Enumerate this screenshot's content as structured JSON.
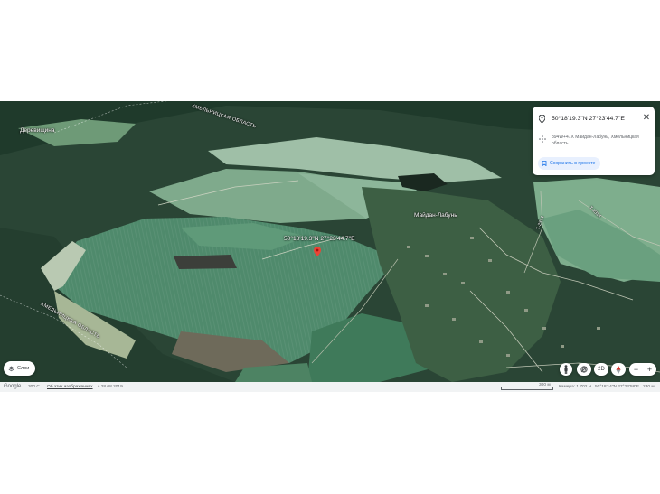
{
  "map": {
    "labels": {
      "village_left": "Деревищина",
      "village_main": "Майдан-Лабунь",
      "region_top": "ХМЕЛЬНИЦКАЯ ОБЛАСТЬ",
      "region_bottom": "ХМЕЛЬНИЦКАЯ ОБЛАСТЬ",
      "pin_coords": "50°18'19.3\"N 27°23'44.7\"E",
      "road_1": "Т-2314",
      "road_2": "Т-2314"
    }
  },
  "info_card": {
    "coordinates": "50°18'19.3\"N 27°23'44.7\"E",
    "address": "894W+47X Майдан-Лабунь, Хмельницкая область",
    "save_label": "Сохранить в проекте",
    "close_glyph": "✕"
  },
  "controls": {
    "layers_label": "Слои",
    "mode_2d_label": "2D",
    "zoom_in": "+",
    "zoom_out": "−"
  },
  "footer": {
    "brand": "Google",
    "copyright": "300 C",
    "about_link": "Об этих изображениях",
    "date": "с 28.08.2019",
    "scale_label": "300 м",
    "camera": "Камера: 1 702 м",
    "cursor_coords": "50°18'14\"N 27°23'58\"E",
    "elevation": "230 м"
  },
  "colors": {
    "accent": "#1a73e8",
    "pin": "#ea4335",
    "compass_red": "#d93025",
    "field_light": "#8fb7a0",
    "forest": "#253f30"
  }
}
